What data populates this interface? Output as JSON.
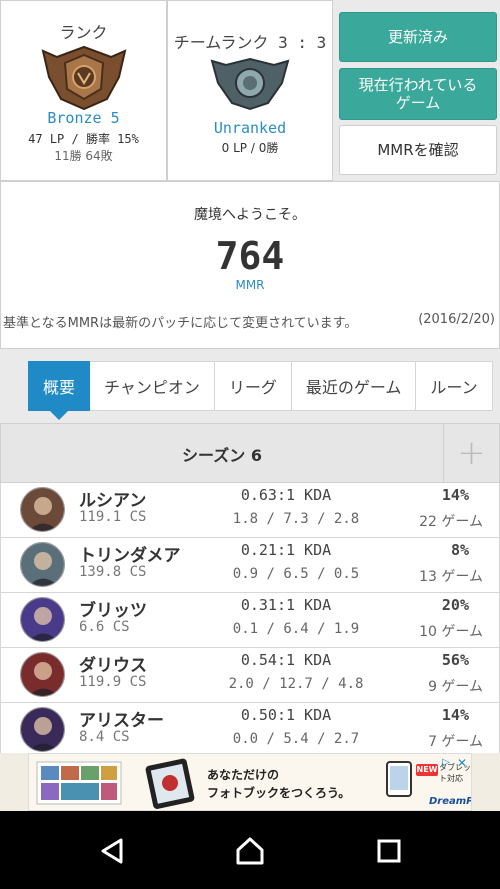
{
  "solo": {
    "title": "ランク",
    "tier": "Bronze 5",
    "lp_winrate": "47 LP / 勝率 15%",
    "wins_losses": "11勝 64敗"
  },
  "team": {
    "title": "チームランク 3 : 3",
    "tier": "Unranked",
    "lp_wins": "0 LP / 0勝"
  },
  "buttons": {
    "updated": "更新済み",
    "live_game": "現在行われている\nゲーム",
    "check_mmr": "MMRを確認"
  },
  "mmr": {
    "welcome": "魔境へようこそ。",
    "value": "764",
    "label": "MMR",
    "note": "基準となるMMRは最新のパッチに応じて変更されています。",
    "date": "(2016/2/20)"
  },
  "tabs": [
    {
      "label": "概要"
    },
    {
      "label": "チャンピオン"
    },
    {
      "label": "リーグ"
    },
    {
      "label": "最近のゲーム"
    },
    {
      "label": "ルーン"
    }
  ],
  "season": {
    "title": "シーズン 6",
    "add_symbol": "+"
  },
  "champions": [
    {
      "name": "ルシアン",
      "cs": "119.1 CS",
      "kda": "0.63:1 KDA",
      "detail": "1.8 / 7.3 / 2.8",
      "pct": "14%",
      "games": "22 ゲーム",
      "icon": "lucian-avatar-icon",
      "color": "#6b4a3a"
    },
    {
      "name": "トリンダメア",
      "cs": "139.8 CS",
      "kda": "0.21:1 KDA",
      "detail": "0.9 / 6.5 / 0.5",
      "pct": "8%",
      "games": "13 ゲーム",
      "icon": "tryndamere-avatar-icon",
      "color": "#5a6f7a"
    },
    {
      "name": "ブリッツ",
      "cs": "6.6 CS",
      "kda": "0.31:1 KDA",
      "detail": "0.1 / 6.4 / 1.9",
      "pct": "20%",
      "games": "10 ゲーム",
      "icon": "blitzcrank-avatar-icon",
      "color": "#4a3a8a"
    },
    {
      "name": "ダリウス",
      "cs": "119.9 CS",
      "kda": "0.54:1 KDA",
      "detail": "2.0 / 12.7 / 4.8",
      "pct": "56%",
      "games": "9 ゲーム",
      "icon": "darius-avatar-icon",
      "color": "#7a2b2b"
    },
    {
      "name": "アリスター",
      "cs": "8.4 CS",
      "kda": "0.50:1 KDA",
      "detail": "0.0 / 5.4 / 2.7",
      "pct": "14%",
      "games": "7 ゲーム",
      "icon": "alistar-avatar-icon",
      "color": "#3a2a5a"
    }
  ],
  "ad": {
    "line1": "あなただけの",
    "line2": "フォトブックをつくろう。",
    "badge": "NEW",
    "small": "タブレット対応",
    "brand": "DreamPages"
  },
  "colors": {
    "accent_teal": "#3aa99c",
    "accent_blue": "#1f8ac6",
    "link_blue": "#2b8cc4"
  }
}
